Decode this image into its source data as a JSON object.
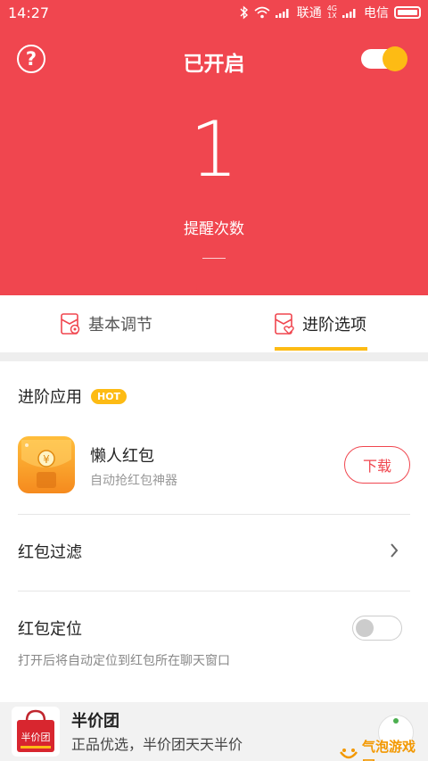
{
  "status_bar": {
    "time": "14:27",
    "carrier_1": "联通",
    "carrier_2": "电信",
    "network_top": "4G",
    "network_bottom": "1X"
  },
  "header": {
    "title": "已开启",
    "help_icon": "question-mark-icon",
    "count": "1",
    "count_label": "提醒次数",
    "toggle_on": true,
    "accent_color": "#f0464f",
    "toggle_color": "#fdbb14"
  },
  "tabs": [
    {
      "label": "基本调节",
      "icon": "envelope-gear-icon",
      "active": false
    },
    {
      "label": "进阶选项",
      "icon": "envelope-heart-icon",
      "active": true
    }
  ],
  "advanced": {
    "section_title": "进阶应用",
    "hot_badge": "HOT",
    "app": {
      "name": "懒人红包",
      "desc": "自动抢红包神器",
      "button": "下载"
    },
    "filter": {
      "label": "红包过滤"
    },
    "locate": {
      "label": "红包定位",
      "desc": "打开后将自动定位到红包所在聊天窗口",
      "enabled": false
    }
  },
  "ad": {
    "icon_text": "半价团",
    "title": "半价团",
    "desc": "正品优选，半价团天天半价"
  },
  "watermark": "气泡游戏网"
}
